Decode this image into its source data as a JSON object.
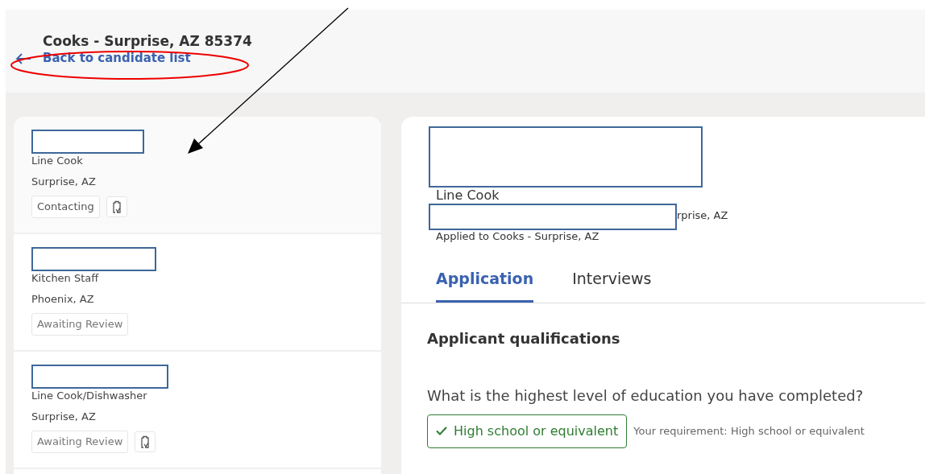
{
  "header": {
    "title": "Cooks - Surprise, AZ 85374",
    "back_link": "Back to candidate list"
  },
  "annotations": {
    "circled_back_link": true,
    "arrow_to_first_candidate": true
  },
  "candidates": [
    {
      "name_redacted": true,
      "job": "Line Cook",
      "location": "Surprise, AZ",
      "status": "Contacting",
      "note_icon": true,
      "selected": true
    },
    {
      "name_redacted": true,
      "job": "Kitchen Staff",
      "location": "Phoenix, AZ",
      "status": "Awaiting Review",
      "note_icon": false,
      "selected": false
    },
    {
      "name_redacted": true,
      "job": "Line Cook/Dishwasher",
      "location": "Surprise, AZ",
      "status": "Awaiting Review",
      "note_icon": true,
      "selected": false
    }
  ],
  "detail": {
    "name_redacted": true,
    "job": "Line Cook",
    "location_redacted": true,
    "location_visible": "rprise, AZ",
    "applied": "Applied to Cooks - Surprise, AZ",
    "tabs": [
      {
        "label": "Application",
        "selected": true
      },
      {
        "label": "Interviews",
        "selected": false
      }
    ],
    "section_title": "Applicant qualifications",
    "questions": [
      {
        "question": "What is the highest level of education you have completed?",
        "answer": "High school or equivalent",
        "meets": true,
        "requirement": "Your requirement: High school or equivalent"
      }
    ]
  }
}
